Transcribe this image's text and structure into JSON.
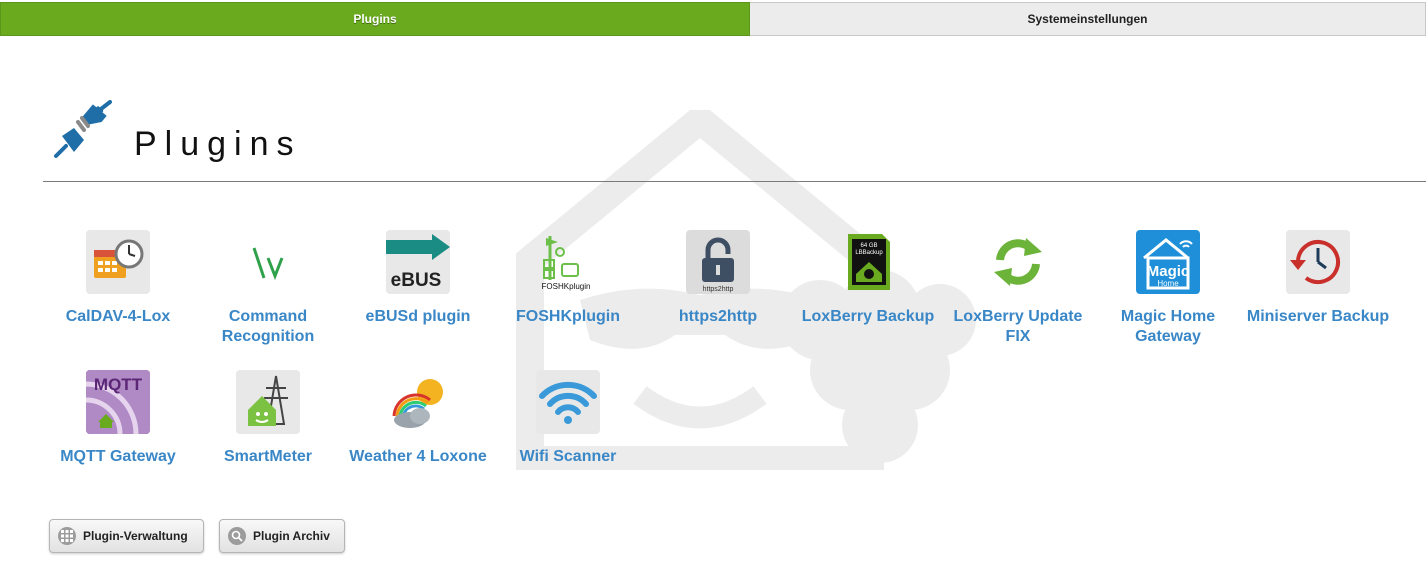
{
  "tabs": [
    {
      "label": "Plugins",
      "active": true
    },
    {
      "label": "Systemeinstellungen",
      "active": false
    }
  ],
  "header": {
    "icon": "plug-icon",
    "title": "Plugins"
  },
  "plugins": [
    {
      "label": "CalDAV-4-Lox",
      "icon": "calendar-clock-icon"
    },
    {
      "label": "Command Recognition",
      "icon": "backslash-v-icon"
    },
    {
      "label": "eBUSd plugin",
      "icon": "ebus-icon",
      "icon_text": "eBUS"
    },
    {
      "label": "FOSHKplugin",
      "icon": "weather-station-icon",
      "icon_text": "FOSHKplugin"
    },
    {
      "label": "https2http",
      "icon": "padlock-icon",
      "icon_text": "https2http"
    },
    {
      "label": "LoxBerry Backup",
      "icon": "sd-card-icon",
      "icon_text": "64 GB LBBackup"
    },
    {
      "label": "LoxBerry Update FIX",
      "icon": "refresh-arrows-icon"
    },
    {
      "label": "Magic Home Gateway",
      "icon": "magic-home-icon",
      "icon_text": "Magic Home"
    },
    {
      "label": "Miniserver Backup",
      "icon": "backup-clock-icon"
    },
    {
      "label": "MQTT Gateway",
      "icon": "mqtt-icon",
      "icon_text": "MQTT"
    },
    {
      "label": "SmartMeter",
      "icon": "smartmeter-icon"
    },
    {
      "label": "Weather 4 Loxone",
      "icon": "weather-icon"
    },
    {
      "label": "Wifi Scanner",
      "icon": "wifi-icon"
    }
  ],
  "buttons": {
    "plugin_management": "Plugin-Verwaltung",
    "plugin_archive": "Plugin Archiv"
  },
  "colors": {
    "active_tab": "#6aaa1f",
    "link_blue": "#3a87c7",
    "brand_blue": "#1f6ea8"
  }
}
